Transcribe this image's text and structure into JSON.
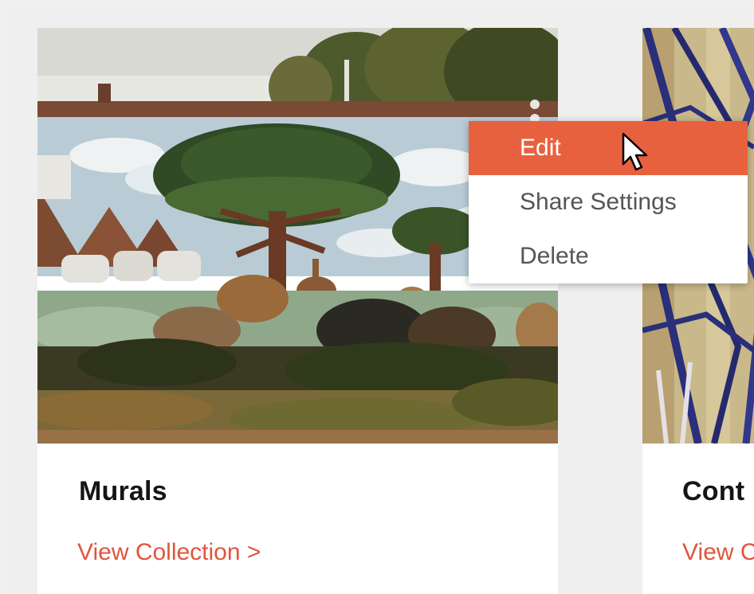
{
  "cards": [
    {
      "title": "Murals",
      "link": "View Collection >",
      "image_icon": "mural-photo"
    },
    {
      "title": "Cont",
      "link": "View C",
      "image_icon": "graffiti-photo"
    }
  ],
  "context_menu": {
    "items": [
      {
        "label": "Edit",
        "state": "hovered"
      },
      {
        "label": "Share Settings"
      },
      {
        "label": "Delete"
      }
    ]
  },
  "icons": {
    "kebab": "vertical-dots-icon",
    "cursor": "mouse-pointer-icon"
  },
  "colors": {
    "accent": "#e8613f",
    "link": "#e0553d",
    "background": "#efefef",
    "card": "#ffffff"
  }
}
